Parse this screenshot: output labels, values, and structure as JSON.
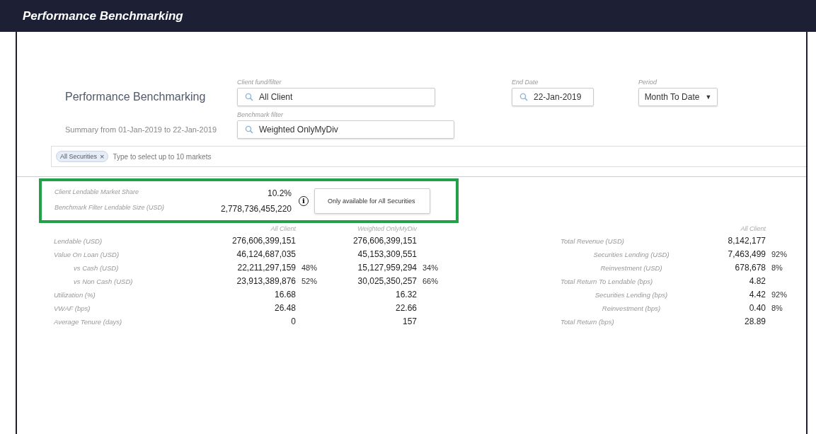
{
  "header": {
    "title": "Performance Benchmarking"
  },
  "page_title": "Performance Benchmarking",
  "summary": "Summary from 01-Jan-2019 to 22-Jan-2019",
  "filters": {
    "client": {
      "label": "Client fund/filter",
      "value": "All Client"
    },
    "end_date": {
      "label": "End Date",
      "value": "22-Jan-2019"
    },
    "period": {
      "label": "Period",
      "value": "Month To Date",
      "caret": "▼"
    },
    "benchmark": {
      "label": "Benchmark filter",
      "value": "Weighted OnlyMyDiv"
    }
  },
  "markets": {
    "tags": [
      {
        "label": "All Securities",
        "remove": "×"
      }
    ],
    "placeholder": "Type to select up to 10 markets"
  },
  "highlight": {
    "metrics": [
      {
        "label": "Client Lendable Market Share",
        "value": "10.2%"
      },
      {
        "label": "Benchmark Filter Lendable Size (USD)",
        "value": "2,778,736,455,220"
      }
    ],
    "info": "i",
    "tooltip": "Only available for All Securities"
  },
  "left_table": {
    "columns": [
      "All Client",
      "Weighted OnlyMyDiv"
    ],
    "rows": [
      {
        "label": "Lendable (USD)",
        "indent": false,
        "cells": [
          {
            "value": "276,606,399,151"
          },
          {
            "value": "276,606,399,151"
          }
        ]
      },
      {
        "label": "Value On Loan (USD)",
        "indent": false,
        "cells": [
          {
            "value": "46,124,687,035"
          },
          {
            "value": "45,153,309,551"
          }
        ]
      },
      {
        "label": "vs Cash (USD)",
        "indent": true,
        "cells": [
          {
            "value": "22,211,297,159",
            "pct": "48%"
          },
          {
            "value": "15,127,959,294",
            "pct": "34%"
          }
        ]
      },
      {
        "label": "vs Non Cash (USD)",
        "indent": true,
        "cells": [
          {
            "value": "23,913,389,876",
            "pct": "52%"
          },
          {
            "value": "30,025,350,257",
            "pct": "66%"
          }
        ]
      },
      {
        "label": "Utilization (%)",
        "indent": false,
        "cells": [
          {
            "value": "16.68"
          },
          {
            "value": "16.32"
          }
        ]
      },
      {
        "label": "VWAF (bps)",
        "indent": false,
        "cells": [
          {
            "value": "26.48"
          },
          {
            "value": "22.66"
          }
        ]
      },
      {
        "label": "Average Tenure (days)",
        "indent": false,
        "cells": [
          {
            "value": "0"
          },
          {
            "value": "157"
          }
        ]
      }
    ]
  },
  "right_table": {
    "columns": [
      "All Client"
    ],
    "rows": [
      {
        "label": "Total Revenue (USD)",
        "indent": false,
        "cells": [
          {
            "value": "8,142,177"
          }
        ]
      },
      {
        "label": "Securities Lending (USD)",
        "indent": true,
        "cells": [
          {
            "value": "7,463,499",
            "pct": "92%"
          }
        ]
      },
      {
        "label": "Reinvestment (USD)",
        "indent": true,
        "cells": [
          {
            "value": "678,678",
            "pct": "8%"
          }
        ]
      },
      {
        "label": "Total Return To Lendable (bps)",
        "indent": false,
        "cells": [
          {
            "value": "4.82"
          }
        ]
      },
      {
        "label": "Securities Lending (bps)",
        "indent": true,
        "cells": [
          {
            "value": "4.42",
            "pct": "92%"
          }
        ]
      },
      {
        "label": "Reinvestment (bps)",
        "indent": true,
        "cells": [
          {
            "value": "0.40",
            "pct": "8%"
          }
        ]
      },
      {
        "label": "Total Return (bps)",
        "indent": false,
        "cells": [
          {
            "value": "28.89"
          }
        ]
      }
    ]
  }
}
